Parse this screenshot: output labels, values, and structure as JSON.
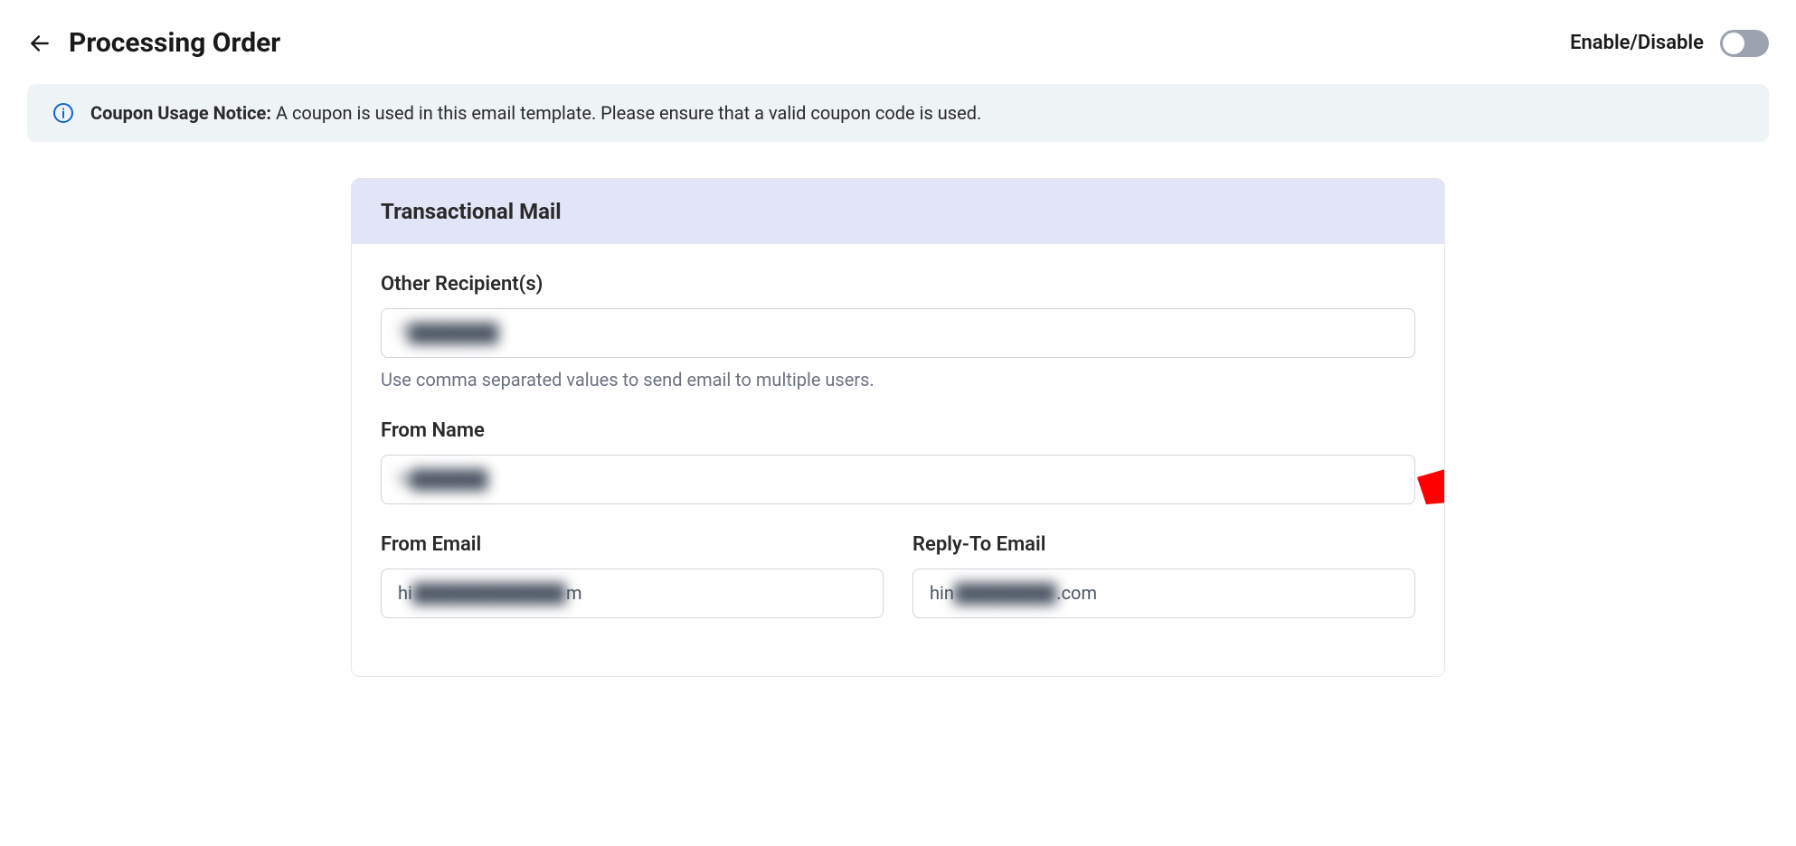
{
  "header": {
    "title": "Processing Order",
    "toggle_label": "Enable/Disable",
    "toggle_state": "off"
  },
  "notice": {
    "title": "Coupon Usage Notice:",
    "message": "A coupon is used in this email template. Please ensure that a valid coupon code is used."
  },
  "card": {
    "title": "Transactional Mail"
  },
  "form": {
    "other_recipients": {
      "label": "Other Recipient(s)",
      "value": "T███████",
      "help": "Use comma separated values to send email to multiple users."
    },
    "from_name": {
      "label": "From Name",
      "value": "N██████"
    },
    "from_email": {
      "label": "From Email",
      "value_prefix": "hi",
      "value_suffix": "m",
      "value_hidden": "████████████"
    },
    "reply_to_email": {
      "label": "Reply-To Email",
      "value_prefix": "hin",
      "value_suffix": ".com",
      "value_hidden": "████████"
    }
  }
}
